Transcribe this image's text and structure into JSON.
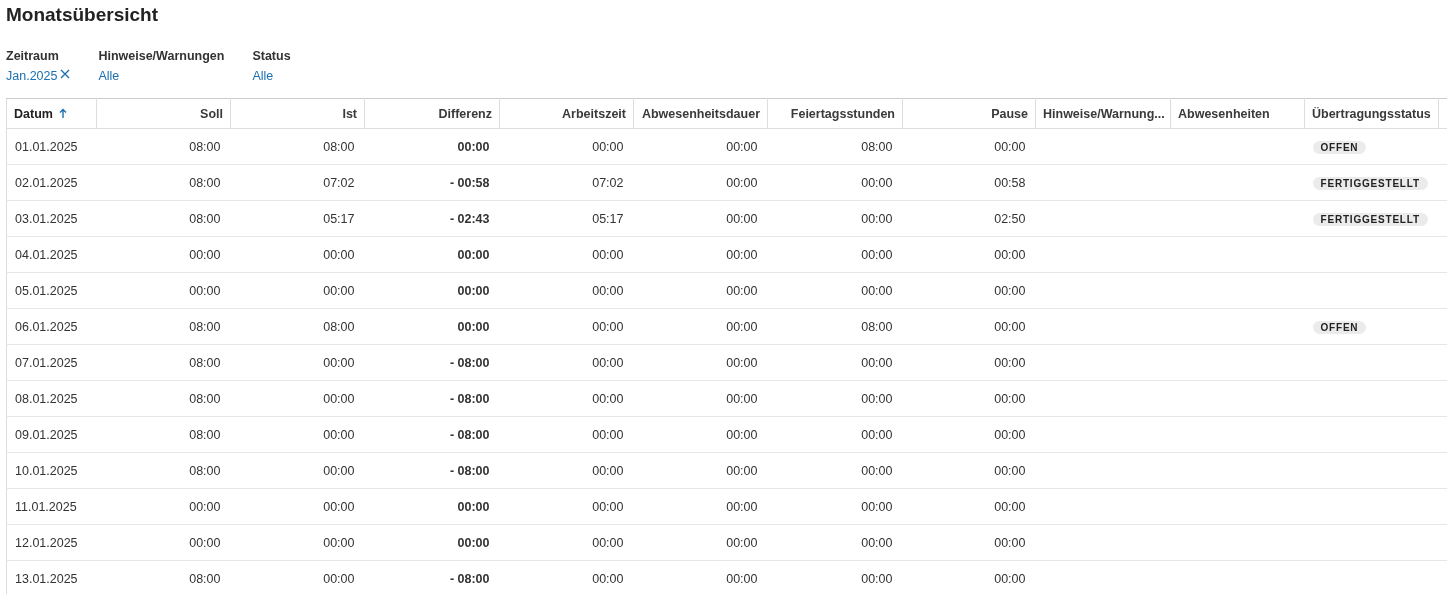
{
  "title": "Monatsübersicht",
  "filters": [
    {
      "label": "Zeitraum",
      "value": "Jan.2025",
      "clearable": true
    },
    {
      "label": "Hinweise/Warnungen",
      "value": "Alle",
      "clearable": false
    },
    {
      "label": "Status",
      "value": "Alle",
      "clearable": false
    }
  ],
  "table": {
    "columns": [
      {
        "label": "Datum",
        "sorted": true
      },
      {
        "label": "Soll",
        "sorted": false
      },
      {
        "label": "Ist",
        "sorted": false
      },
      {
        "label": "Differenz",
        "sorted": false
      },
      {
        "label": "Arbeitszeit",
        "sorted": false
      },
      {
        "label": "Abwesenheitsdauer",
        "sorted": false
      },
      {
        "label": "Feiertagsstunden",
        "sorted": false
      },
      {
        "label": "Pause",
        "sorted": false
      },
      {
        "label": "Hinweise/Warnung...",
        "sorted": false
      },
      {
        "label": "Abwesenheiten",
        "sorted": false
      },
      {
        "label": "Übertragungsstatus",
        "sorted": false
      }
    ],
    "rows": [
      {
        "cells": [
          "01.01.2025",
          "08:00",
          "08:00",
          "00:00",
          "00:00",
          "00:00",
          "08:00",
          "00:00"
        ],
        "status": "OFFEN"
      },
      {
        "cells": [
          "02.01.2025",
          "08:00",
          "07:02",
          "- 00:58",
          "07:02",
          "00:00",
          "00:00",
          "00:58"
        ],
        "status": "FERTIGGESTELLT"
      },
      {
        "cells": [
          "03.01.2025",
          "08:00",
          "05:17",
          "- 02:43",
          "05:17",
          "00:00",
          "00:00",
          "02:50"
        ],
        "status": "FERTIGGESTELLT"
      },
      {
        "cells": [
          "04.01.2025",
          "00:00",
          "00:00",
          "00:00",
          "00:00",
          "00:00",
          "00:00",
          "00:00"
        ]
      },
      {
        "cells": [
          "05.01.2025",
          "00:00",
          "00:00",
          "00:00",
          "00:00",
          "00:00",
          "00:00",
          "00:00"
        ]
      },
      {
        "cells": [
          "06.01.2025",
          "08:00",
          "08:00",
          "00:00",
          "00:00",
          "00:00",
          "08:00",
          "00:00"
        ],
        "status": "OFFEN"
      },
      {
        "cells": [
          "07.01.2025",
          "08:00",
          "00:00",
          "- 08:00",
          "00:00",
          "00:00",
          "00:00",
          "00:00"
        ]
      },
      {
        "cells": [
          "08.01.2025",
          "08:00",
          "00:00",
          "- 08:00",
          "00:00",
          "00:00",
          "00:00",
          "00:00"
        ]
      },
      {
        "cells": [
          "09.01.2025",
          "08:00",
          "00:00",
          "- 08:00",
          "00:00",
          "00:00",
          "00:00",
          "00:00"
        ]
      },
      {
        "cells": [
          "10.01.2025",
          "08:00",
          "00:00",
          "- 08:00",
          "00:00",
          "00:00",
          "00:00",
          "00:00"
        ]
      },
      {
        "cells": [
          "11.01.2025",
          "00:00",
          "00:00",
          "00:00",
          "00:00",
          "00:00",
          "00:00",
          "00:00"
        ]
      },
      {
        "cells": [
          "12.01.2025",
          "00:00",
          "00:00",
          "00:00",
          "00:00",
          "00:00",
          "00:00",
          "00:00"
        ]
      },
      {
        "cells": [
          "13.01.2025",
          "08:00",
          "00:00",
          "- 08:00",
          "00:00",
          "00:00",
          "00:00",
          "00:00"
        ]
      }
    ]
  }
}
